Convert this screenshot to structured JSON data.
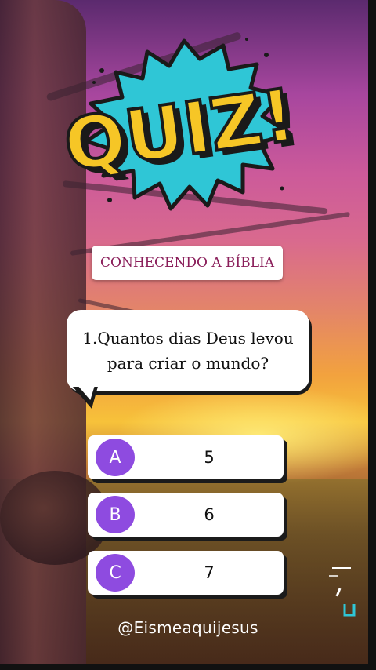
{
  "logo": {
    "text": "QUIZ!",
    "colors": {
      "fill": "#f6c626",
      "outline": "#1a1a1a",
      "burst": "#2fc6d6"
    }
  },
  "category_label": "CONHECENDO A BÍBLIA",
  "question": {
    "text": "1.Quantos dias Deus levou para criar o mundo?"
  },
  "options": [
    {
      "letter": "A",
      "text": "5"
    },
    {
      "letter": "B",
      "text": "6"
    },
    {
      "letter": "C",
      "text": "7"
    }
  ],
  "footer": {
    "handle": "@Eismeaquijesus"
  },
  "colors": {
    "option_badge": "#8e4be0",
    "category_text": "#8a1e5a"
  }
}
